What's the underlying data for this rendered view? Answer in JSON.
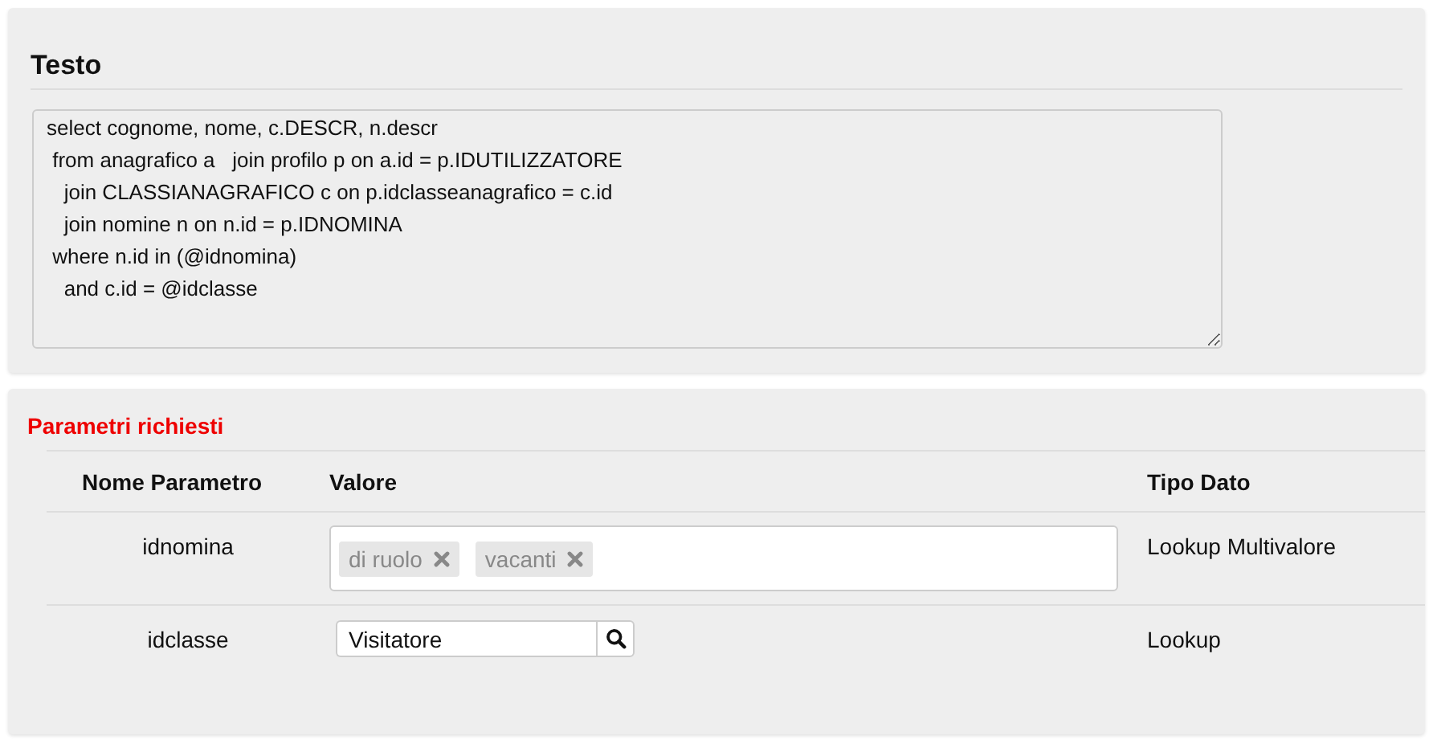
{
  "text_panel": {
    "title": "Testo",
    "query_lines": [
      "select cognome, nome, c.DESCR, n.descr",
      " from anagrafico a   join profilo p on a.id = p.IDUTILIZZATORE",
      "   join CLASSIANAGRAFICO c on p.idclasseanagrafico = c.id",
      "   join nomine n on n.id = p.IDNOMINA",
      " where n.id in (@idnomina)",
      "   and c.id = @idclasse"
    ]
  },
  "params_panel": {
    "title": "Parametri richiesti",
    "columns": [
      "Nome Parametro",
      "Valore",
      "Tipo Dato"
    ],
    "rows": [
      {
        "name": "idnomina",
        "kind": "multi",
        "tags": [
          "di ruolo",
          "vacanti"
        ],
        "type": "Lookup Multivalore"
      },
      {
        "name": "idclasse",
        "kind": "lookup",
        "value": "Visitatore",
        "type": "Lookup"
      }
    ]
  }
}
